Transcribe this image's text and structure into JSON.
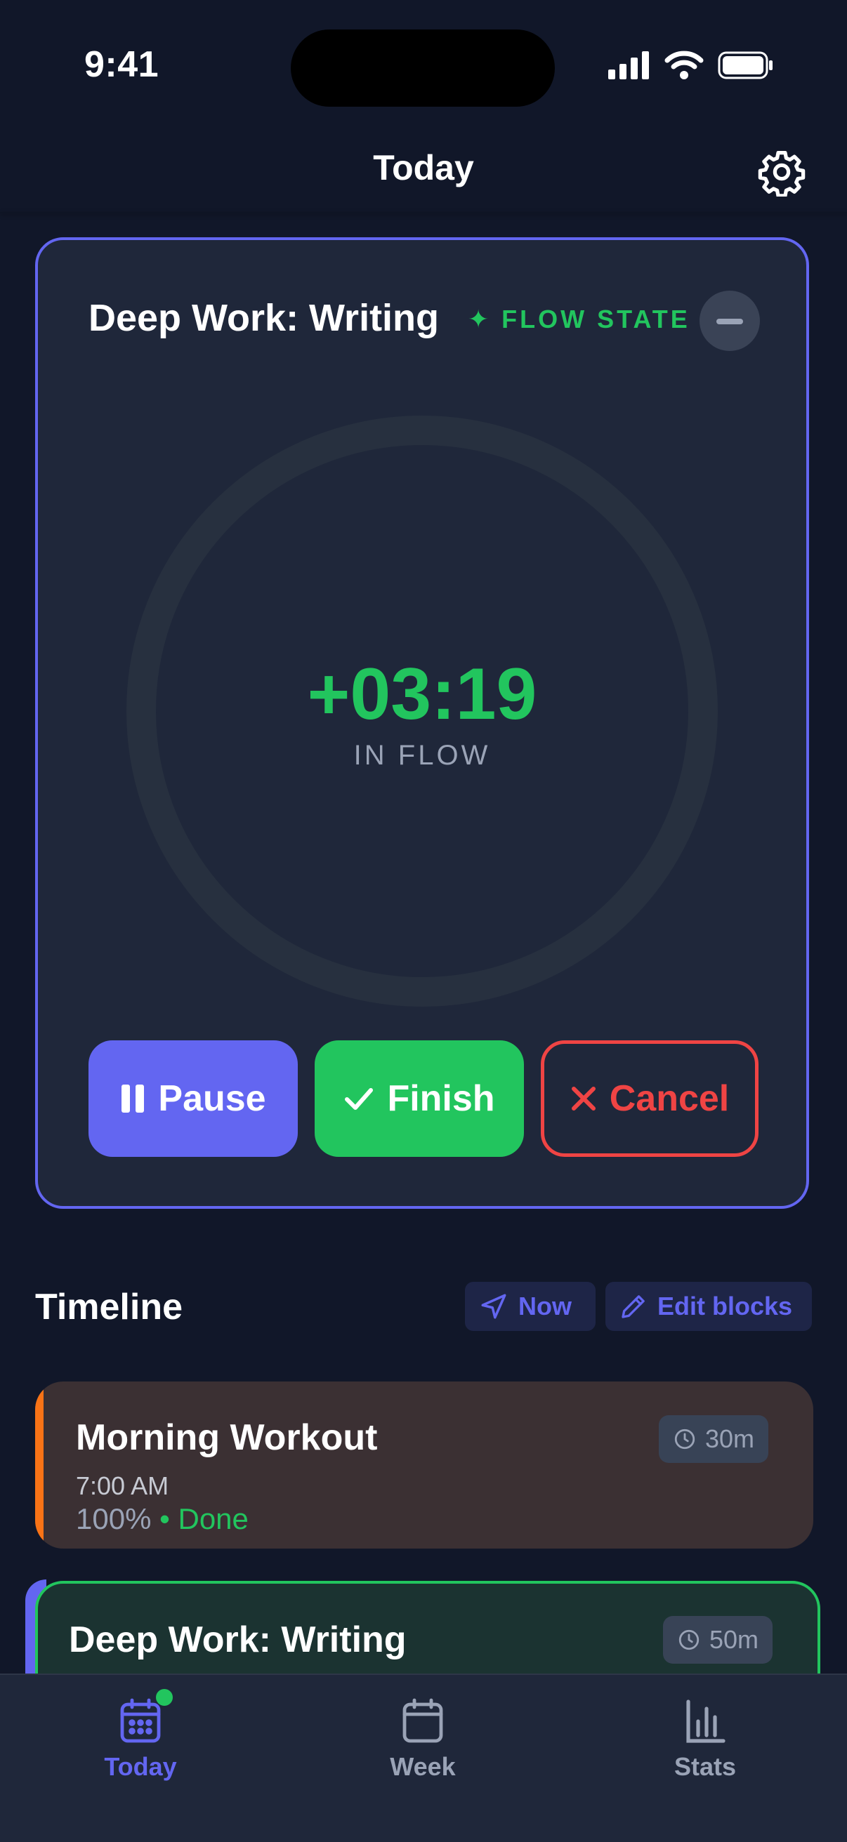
{
  "status_bar": {
    "time": "9:41"
  },
  "nav": {
    "title": "Today"
  },
  "focus_card": {
    "title": "Deep Work: Writing",
    "badge": "✦ FLOW STATE",
    "timer": "+03:19",
    "timer_sub": "IN FLOW",
    "buttons": {
      "pause": "Pause",
      "finish": "Finish",
      "cancel": "Cancel"
    }
  },
  "timeline": {
    "title": "Timeline",
    "now_label": "Now",
    "edit_label": "Edit blocks",
    "items": [
      {
        "title": "Morning Workout",
        "time": "7:00 AM",
        "progress": "100%",
        "separator": "•",
        "status": "Done",
        "duration": "30m"
      },
      {
        "title": "Deep Work: Writing",
        "duration": "50m"
      }
    ]
  },
  "tabs": [
    {
      "label": "Today"
    },
    {
      "label": "Week"
    },
    {
      "label": "Stats"
    }
  ],
  "colors": {
    "background": "#111729",
    "card": "#1f273a",
    "accent": "#6366f1",
    "success": "#22c55e",
    "danger": "#ef4444",
    "workout": "#f97316"
  }
}
